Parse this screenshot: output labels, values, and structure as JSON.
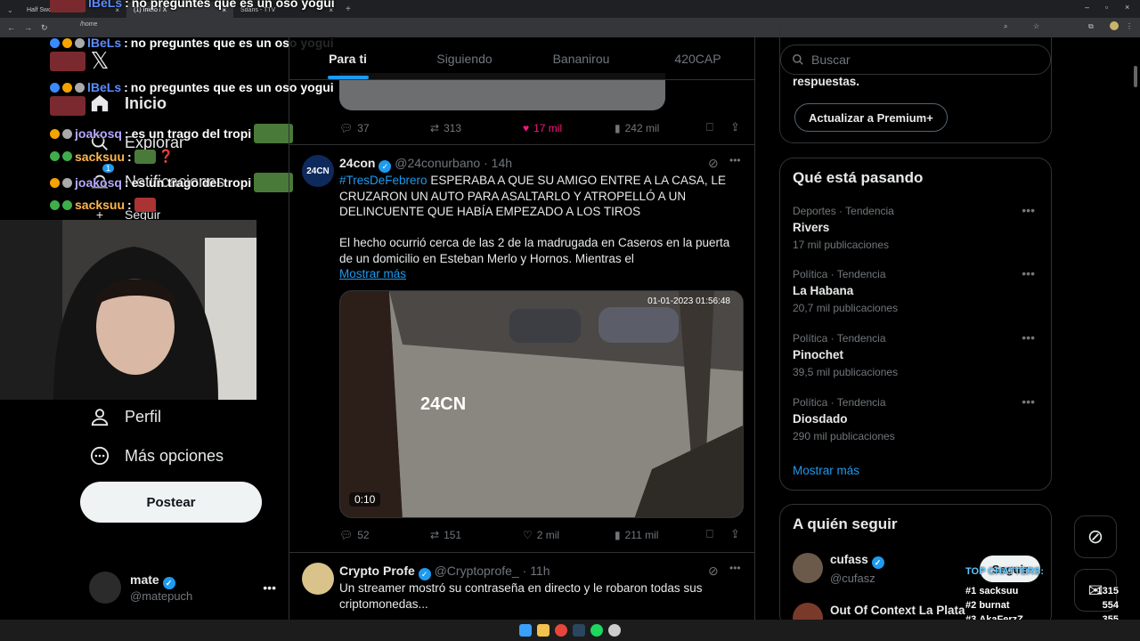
{
  "browser": {
    "tabs": [
      {
        "label": "Half Sword on Steam"
      },
      {
        "label": "(1) Inicio / X"
      },
      {
        "label": "Sdans - TTV"
      }
    ],
    "url": "/home"
  },
  "chat": {
    "lines": [
      {
        "user": "lBeLs",
        "message": "no preguntes que es un oso yogui"
      },
      {
        "user": "lBeLs",
        "message": "no preguntes que es un oso yogui"
      },
      {
        "user": "lBeLs",
        "message": "no preguntes que es un oso yogui"
      },
      {
        "user": "joakosq",
        "message": "es un trago del tropi"
      },
      {
        "user": "sacksuu",
        "message": "❓"
      },
      {
        "user": "joakosq",
        "message": "es un trago del tropi"
      },
      {
        "user": "sacksuu",
        "message": ""
      }
    ]
  },
  "nav": {
    "home": "Inicio",
    "explore": "Explorar",
    "notifications": "Notificaciones",
    "follow": "Seguir",
    "profile": "Perfil",
    "more": "Más opciones",
    "post_button": "Postear",
    "notif_badge": "1",
    "account": {
      "name": "mate",
      "handle": "@matepuch"
    }
  },
  "feed": {
    "tabs": [
      "Para ti",
      "Siguiendo",
      "Bananirou",
      "420CAP"
    ],
    "prev_tweet": {
      "replies": "37",
      "reposts": "313",
      "likes": "17 mil",
      "views": "242 mil"
    },
    "tweet1": {
      "name": "24con",
      "handle": "@24conurbano",
      "time": "14h",
      "hashtag": "#TresDeFebrero",
      "text1": "ESPERABA A QUE SU AMIGO ENTRE A LA CASA, LE CRUZARON UN AUTO PARA ASALTARLO Y ATROPELLÓ A UN DELINCUENTE QUE HABÍA EMPEZADO A LOS TIROS",
      "text2": "El hecho ocurrió cerca de las 2 de la madrugada en Caseros en la puerta de un domicilio en Esteban Merlo y Hornos. Mientras el",
      "show_more": "Mostrar más",
      "video_timestamp": "01-01-2023 01:56:48",
      "video_logo": "24CN",
      "video_duration": "0:10",
      "replies": "52",
      "reposts": "151",
      "likes": "2 mil",
      "views": "211 mil"
    },
    "tweet2": {
      "name": "Crypto Profe",
      "handle": "@Cryptoprofe_",
      "time": "11h",
      "text": "Un streamer mostró su contraseña en directo y le robaron todas sus criptomonedas..."
    }
  },
  "right": {
    "search_placeholder": "Buscar",
    "premium_tail": "respuestas.",
    "premium_button": "Actualizar a Premium+",
    "trends_title": "Qué está pasando",
    "trends": [
      {
        "meta": "Deportes · Tendencia",
        "title": "Rivers",
        "count": "17 mil publicaciones"
      },
      {
        "meta": "Política · Tendencia",
        "title": "La Habana",
        "count": "20,7 mil publicaciones"
      },
      {
        "meta": "Política · Tendencia",
        "title": "Pinochet",
        "count": "39,5 mil publicaciones"
      },
      {
        "meta": "Política · Tendencia",
        "title": "Diosdado",
        "count": "290 mil publicaciones"
      }
    ],
    "show_more": "Mostrar más",
    "follow_title": "A quién seguir",
    "follow": [
      {
        "name": "cufass",
        "handle": "@cufasz",
        "button": "Seguir"
      },
      {
        "name": "Out Of Context La Plata",
        "handle": ""
      }
    ]
  },
  "top_chatters": {
    "title": "TOP CHATTERS:",
    "entries": [
      {
        "rank": "#1",
        "name": "sacksuu",
        "count": "1315"
      },
      {
        "rank": "#2",
        "name": "burnat",
        "count": "554"
      },
      {
        "rank": "#3",
        "name": "AkaFerzZ",
        "count": "355"
      }
    ]
  },
  "colors": {
    "accent": "#1d9bf0",
    "like": "#f91880",
    "bg": "#000000",
    "border": "#2f3336"
  }
}
